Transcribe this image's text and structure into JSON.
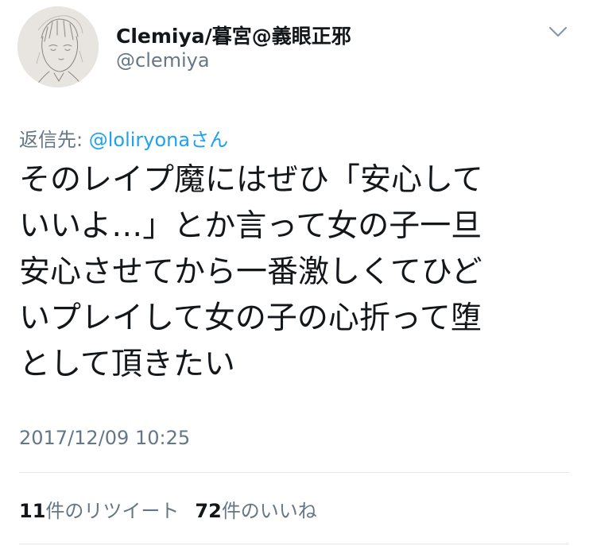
{
  "author": {
    "display_name": "Clemiya/暮宮@義眼正邪",
    "handle": "@clemiya"
  },
  "reply": {
    "prefix": "返信先:",
    "mention": "@loliryonaさん"
  },
  "tweet": {
    "lines": [
      "そのレイプ魔にはぜひ「安心して",
      "いいよ…」とか言って女の子一旦",
      "安心させてから一番激しくてひど",
      "いプレイして女の子の心折って堕",
      "として頂きたい"
    ],
    "timestamp": "2017/12/09 10:25"
  },
  "stats": {
    "retweets_count": "11",
    "retweets_label": "件のリツイート",
    "likes_count": "72",
    "likes_label": "件のいいね"
  },
  "icons": {
    "menu": "chevron-down-icon"
  },
  "colors": {
    "text": "#14171a",
    "secondary": "#657786",
    "link": "#1da1f2",
    "divider": "#e1e8ed"
  }
}
